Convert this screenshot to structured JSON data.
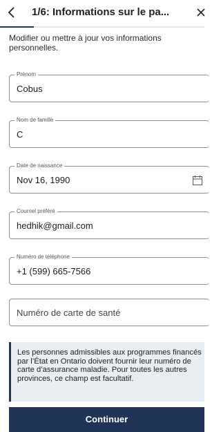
{
  "header": {
    "back_glyph": "‹",
    "title": "1/6: Informations sur le pa...",
    "close_glyph": "×",
    "progress_fraction": 0.1667
  },
  "intro": "Modifier ou mettre à jour vos informations personnelles.",
  "fields": {
    "first_name": {
      "label": "Prénom",
      "value": "Cobus"
    },
    "last_name": {
      "label": "Nom de famille",
      "value": "C"
    },
    "birth_date": {
      "label": "Date de naissance",
      "value": "Nov 16, 1990"
    },
    "email": {
      "label": "Courriel préféré",
      "value": "hedhik@gmail.com"
    },
    "phone": {
      "label": "Numéro de téléphone",
      "value": "+1 (599) 665-7566"
    },
    "health_card": {
      "placeholder": "Numéro de carte de santé"
    }
  },
  "info_text": "Les personnes admissibles aux programmes financés par l’État en Ontario doivent fournir leur numéro de carte d’assurance maladie. Pour toutes les autres provinces, ce champ est facultatif.",
  "continue_label": "Continuer",
  "colors": {
    "brand_navy": "#1f3457",
    "info_background": "#e8eef2"
  },
  "icons": {
    "back": "chevron-left-icon",
    "close": "close-icon",
    "calendar": "calendar-icon"
  }
}
